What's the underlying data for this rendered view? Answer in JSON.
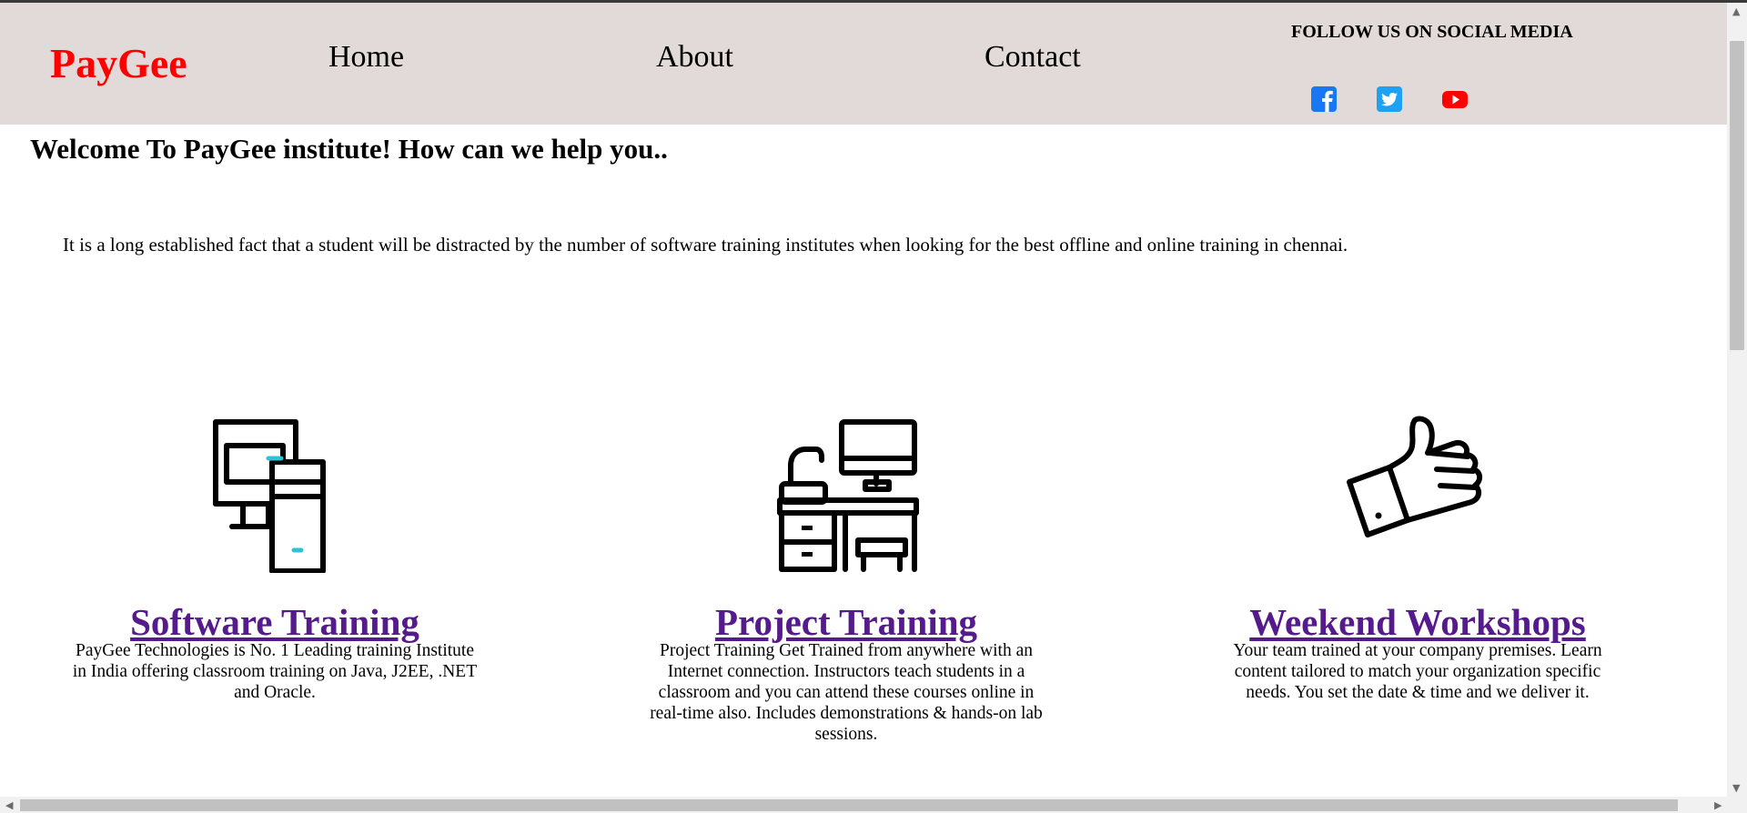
{
  "header": {
    "brand": "PayGee",
    "nav": {
      "home": "Home",
      "about": "About",
      "contact": "Contact"
    },
    "social_title": "FOLLOW US ON SOCIAL MEDIA",
    "social": [
      {
        "icon": "facebook-icon",
        "color": "#1877f2"
      },
      {
        "icon": "twitter-icon",
        "color": "#1da1f2"
      },
      {
        "icon": "youtube-icon",
        "color": "#ff0000"
      }
    ]
  },
  "main": {
    "welcome": "Welcome To PayGee institute! How can we help you..",
    "intro": "It is a long established fact that a student will be distracted by the number of software training institutes when looking for the best offline and online training in chennai.",
    "cards": [
      {
        "icon": "computer-icon",
        "title": "Software Training",
        "desc": "PayGee Technologies is No. 1 Leading training Institute in India offering classroom training on Java, J2EE, .NET and Oracle."
      },
      {
        "icon": "desk-workstation-icon",
        "title": "Project Training",
        "desc": "Project Training Get Trained from anywhere with an Internet connection. Instructors teach students in a classroom and you can attend these courses online in real-time also. Includes demonstrations & hands-on lab sessions."
      },
      {
        "icon": "thumbs-up-icon",
        "title": "Weekend Workshops",
        "desc": "Your team trained at your company premises. Learn content tailored to match your organization specific needs. You set the date & time and we deliver it."
      }
    ]
  },
  "colors": {
    "header_bg": "#e2dad9",
    "brand": "#ff0000",
    "link_visited": "#551a8b",
    "accent_cyan": "#2ec4d6"
  }
}
